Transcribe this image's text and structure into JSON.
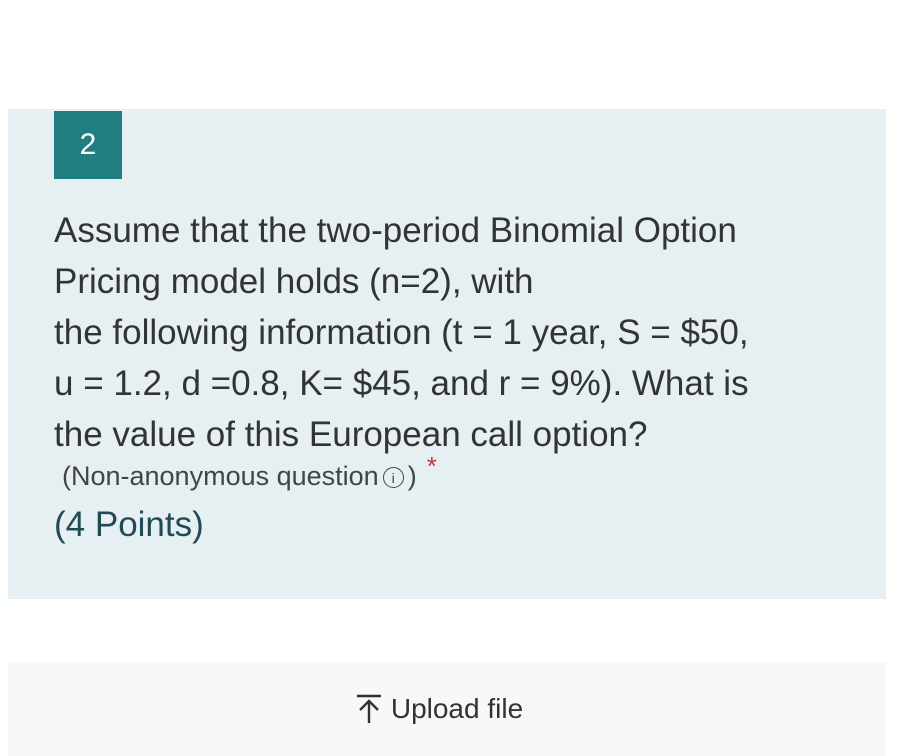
{
  "question": {
    "number": "2",
    "text_lines": [
      "Assume that the two-period Binomial Option",
      "Pricing model holds (n=2), with",
      "the following information (t = 1 year, S = $50,",
      "u = 1.2, d =0.8, K= $45, and r = 9%). What is",
      "the value of this European call option?"
    ],
    "meta_open": "(Non-anonymous question",
    "meta_icon": "i",
    "meta_close": ")",
    "required_marker": "*",
    "points": "(4 Points)"
  },
  "upload": {
    "label": "Upload file",
    "icon": "upload-arrow-icon"
  },
  "colors": {
    "card_background": "#e6eff1",
    "badge_background": "#1f7f80",
    "required": "#d13438",
    "points_text": "#214a57"
  }
}
